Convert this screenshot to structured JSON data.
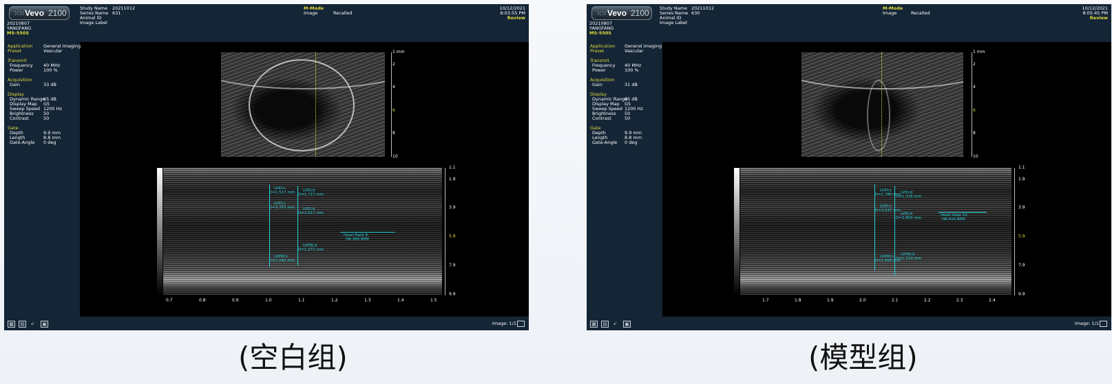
{
  "panels": [
    {
      "logo": {
        "brand": "Vevo",
        "model": "2100"
      },
      "header": {
        "study_name_label": "Study Name",
        "study_name": "20211012",
        "series_name_label": "Series Name",
        "series_name": "631",
        "animal_id_label": "Animal ID",
        "image_label_label": "Image Label",
        "mode": "M-Mode",
        "image_label": "Image",
        "image_status": "Recalled",
        "date": "10/12/2021",
        "time": "8:03:55 PM",
        "review": "Review",
        "patient_date": "20210807",
        "operator": "YANGFANG",
        "probe": "MS-550S"
      },
      "settings": {
        "application_label": "Application",
        "application": "General Imaging",
        "preset_label": "Preset",
        "preset": "Vascular",
        "transmit_title": "Transmit",
        "frequency_label": "Frequency",
        "frequency": "40 MHz",
        "power_label": "Power",
        "power": "100 %",
        "acquisition_title": "Acquisition",
        "gain_label": "Gain",
        "gain": "33 dB",
        "display_title": "Display",
        "dynamic_range_label": "Dynamic Range",
        "dynamic_range": "65 dB",
        "display_map_label": "Display Map",
        "display_map": "G5",
        "sweep_speed_label": "Sweep Speed",
        "sweep_speed": "1200 Hz",
        "brightness_label": "Brightness",
        "brightness": "50",
        "contrast_label": "Contrast",
        "contrast": "50",
        "gate_title": "Gate",
        "depth_label": "Depth",
        "depth": "9.9 mm",
        "length_label": "Length",
        "length": "8.8 mm",
        "gate_angle_label": "Gate-Angle",
        "gate_angle": "0 deg"
      },
      "bmode_scale": [
        "1 mm",
        "2",
        "4",
        "6",
        "8",
        "10"
      ],
      "mmode_scale": [
        "1.1",
        "1.9",
        "3.9",
        "5.9",
        "7.9",
        "9.9"
      ],
      "time_axis": [
        "0.7",
        "0.8",
        "0.9",
        "1.0",
        "1.1",
        "1.2",
        "1.3",
        "1.4",
        "1.5"
      ],
      "measurements": {
        "lvid_s_top": "LVID;s",
        "lvid_s_top_val": "D=1.517 mm",
        "lvid_d_top": "LVID;d",
        "lvid_d_top_val": "D=1.717 mm",
        "lvid_s": "LVID;s",
        "lvid_s_val": "D=3.757 mm",
        "lvid_d": "LVID;d",
        "lvid_d_val": "D=2.617 mm",
        "lvpw_s": "LVPW;s",
        "lvpw_s_val": "D=1.042 mm",
        "lvpw_d": "LVPW;d",
        "lvpw_d_val": "D=1.271 mm",
        "heart_rate": "Heart Rate 9:",
        "heart_rate_val": "HR:389 BPM"
      },
      "footer": {
        "image_count": "Image: 1/1"
      }
    },
    {
      "logo": {
        "brand": "Vevo",
        "model": "2100"
      },
      "header": {
        "study_name_label": "Study Name",
        "study_name": "20211012",
        "series_name_label": "Series Name",
        "series_name": "630",
        "animal_id_label": "Animal ID",
        "image_label_label": "Image Label",
        "mode": "M-Mode",
        "image_label": "Image",
        "image_status": "Recalled",
        "date": "10/12/2021",
        "time": "8:05:45 PM",
        "review": "Review",
        "patient_date": "20210807",
        "operator": "YANGFANG",
        "probe": "MS-550S"
      },
      "settings": {
        "application_label": "Application",
        "application": "General Imaging",
        "preset_label": "Preset",
        "preset": "Vascular",
        "transmit_title": "Transmit",
        "frequency_label": "Frequency",
        "frequency": "40 MHz",
        "power_label": "Power",
        "power": "100 %",
        "acquisition_title": "Acquisition",
        "gain_label": "Gain",
        "gain": "31 dB",
        "display_title": "Display",
        "dynamic_range_label": "Dynamic Range",
        "dynamic_range": "65 dB",
        "display_map_label": "Display Map",
        "display_map": "G5",
        "sweep_speed_label": "Sweep Speed",
        "sweep_speed": "1200 Hz",
        "brightness_label": "Brightness",
        "brightness": "50",
        "contrast_label": "Contrast",
        "contrast": "50",
        "gate_title": "Gate",
        "depth_label": "Depth",
        "depth": "9.9 mm",
        "length_label": "Length",
        "length": "8.8 mm",
        "gate_angle_label": "Gate-Angle",
        "gate_angle": "0 deg"
      },
      "bmode_scale": [
        "1 mm",
        "2",
        "4",
        "6",
        "8",
        "10"
      ],
      "mmode_scale": [
        "1.1",
        "1.9",
        "3.9",
        "5.9",
        "7.9",
        "9.9"
      ],
      "time_axis": [
        "1.7",
        "1.8",
        "1.9",
        "2.0",
        "2.1",
        "2.2",
        "2.3",
        "2.4"
      ],
      "measurements": {
        "lvid_s_top": "LVID;s",
        "lvid_s_top_val": "D=1.780 mm",
        "lvid_d_top": "LVID;d",
        "lvid_d_top_val": "D=1.378 mm",
        "lvid_s": "LVID;s",
        "lvid_s_val": "D=3.547 mm",
        "lvid_d": "LVID;d",
        "lvid_d_val": "D=2.803 mm",
        "lvpw_s": "LVPW;s",
        "lvpw_s_val": "D=1.605 mm",
        "lvpw_d": "LVPW;d",
        "lvpw_d_val": "D=1.314 mm",
        "heart_rate": "Heart Rate 10:",
        "heart_rate_val": "HR:416 BPM"
      },
      "footer": {
        "image_count": "Image: 1/1"
      }
    }
  ],
  "captions": [
    "(空白组)",
    "(模型组)"
  ],
  "colors": {
    "panel_bg": "#142536",
    "label_yellow": "#e3dd3a",
    "measure_cyan": "#27d3dd"
  }
}
